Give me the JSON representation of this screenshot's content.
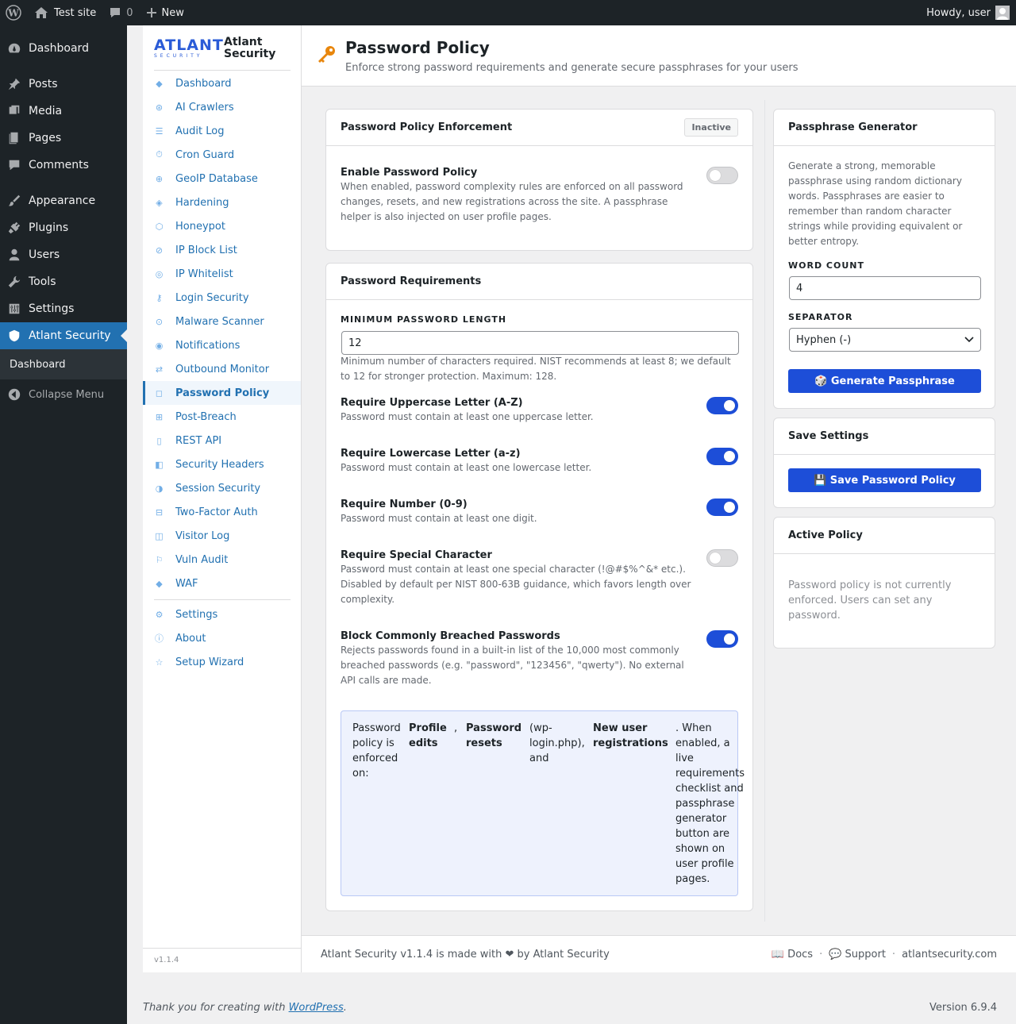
{
  "adminbar": {
    "site_name": "Test site",
    "comments_count": "0",
    "new_label": "New",
    "howdy": "Howdy, user"
  },
  "wp_menu": {
    "items": [
      {
        "label": "Dashboard",
        "icon": "dashboard-icon"
      },
      {
        "label": "Posts",
        "icon": "pin-icon"
      },
      {
        "label": "Media",
        "icon": "media-icon"
      },
      {
        "label": "Pages",
        "icon": "pages-icon"
      },
      {
        "label": "Comments",
        "icon": "comment-icon"
      },
      {
        "label": "Appearance",
        "icon": "brush-icon"
      },
      {
        "label": "Plugins",
        "icon": "plug-icon"
      },
      {
        "label": "Users",
        "icon": "user-icon"
      },
      {
        "label": "Tools",
        "icon": "wrench-icon"
      },
      {
        "label": "Settings",
        "icon": "sliders-icon"
      },
      {
        "label": "Atlant Security",
        "icon": "shield-icon"
      }
    ],
    "submenu": "Dashboard",
    "collapse": "Collapse Menu"
  },
  "plugin": {
    "brand_logo": "ATLANT",
    "brand_logo_sub": "SECURITY",
    "brand_name_1": "Atlant",
    "brand_name_2": "Security",
    "nav": [
      {
        "label": "Dashboard",
        "glyph": "◆"
      },
      {
        "label": "AI Crawlers",
        "glyph": "⊛"
      },
      {
        "label": "Audit Log",
        "glyph": "☰"
      },
      {
        "label": "Cron Guard",
        "glyph": "⏱"
      },
      {
        "label": "GeoIP Database",
        "glyph": "⊕"
      },
      {
        "label": "Hardening",
        "glyph": "◈"
      },
      {
        "label": "Honeypot",
        "glyph": "⬡"
      },
      {
        "label": "IP Block List",
        "glyph": "⊘"
      },
      {
        "label": "IP Whitelist",
        "glyph": "◎"
      },
      {
        "label": "Login Security",
        "glyph": "⚷"
      },
      {
        "label": "Malware Scanner",
        "glyph": "⊙"
      },
      {
        "label": "Notifications",
        "glyph": "◉"
      },
      {
        "label": "Outbound Monitor",
        "glyph": "⇄"
      },
      {
        "label": "Password Policy",
        "glyph": "◻"
      },
      {
        "label": "Post-Breach",
        "glyph": "⊞"
      },
      {
        "label": "REST API",
        "glyph": "▯"
      },
      {
        "label": "Security Headers",
        "glyph": "◧"
      },
      {
        "label": "Session Security",
        "glyph": "◑"
      },
      {
        "label": "Two-Factor Auth",
        "glyph": "⊟"
      },
      {
        "label": "Visitor Log",
        "glyph": "◫"
      },
      {
        "label": "Vuln Audit",
        "glyph": "⚐"
      },
      {
        "label": "WAF",
        "glyph": "◆"
      }
    ],
    "nav_bottom": [
      {
        "label": "Settings",
        "glyph": "⚙"
      },
      {
        "label": "About",
        "glyph": "ⓘ"
      },
      {
        "label": "Setup Wizard",
        "glyph": "☆"
      }
    ],
    "version": "v1.1.4"
  },
  "page": {
    "title": "Password Policy",
    "subtitle": "Enforce strong password requirements and generate secure passphrases for your users"
  },
  "enforcement": {
    "title": "Password Policy Enforcement",
    "badge": "Inactive",
    "enable_title": "Enable Password Policy",
    "enable_desc_1": "When enabled, password complexity rules are enforced on all password",
    "enable_desc_2": "changes, resets, and new registrations across the site. A passphrase",
    "enable_desc_3": "helper is also injected on user profile pages.",
    "enabled": false
  },
  "requirements": {
    "title": "Password Requirements",
    "min_length_label": "MINIMUM PASSWORD LENGTH",
    "min_length_value": "12",
    "min_length_help_1": "Minimum number of characters required. NIST recommends at least 8; we default",
    "min_length_help_2": "to 12 for stronger protection. Maximum: 128.",
    "rules": [
      {
        "title": "Require Uppercase Letter (A-Z)",
        "lines": [
          "Password must contain at least one uppercase letter."
        ],
        "on": true
      },
      {
        "title": "Require Lowercase Letter (a-z)",
        "lines": [
          "Password must contain at least one lowercase letter."
        ],
        "on": true
      },
      {
        "title": "Require Number (0-9)",
        "lines": [
          "Password must contain at least one digit."
        ],
        "on": true
      },
      {
        "title": "Require Special Character",
        "lines": [
          "Password must contain at least one special character (!@#$%^&* etc.).",
          "Disabled by default per NIST 800-63B guidance, which favors length over",
          "complexity."
        ],
        "on": false
      },
      {
        "title": "Block Commonly Breached Passwords",
        "lines": [
          "Rejects passwords found in a built-in list of the 10,000 most commonly",
          "breached passwords (e.g. \"password\", \"123456\", \"qwerty\"). No external",
          "API calls are made."
        ],
        "on": true
      }
    ],
    "info": {
      "c1": [
        "Password",
        "policy is",
        "enforced",
        "on:"
      ],
      "c2": [
        "Profile",
        "edits"
      ],
      "c3": [
        ","
      ],
      "c4": [
        "Password",
        "resets"
      ],
      "c5": [
        "(wp-",
        "login.php),",
        "and"
      ],
      "c6": [
        "New user",
        "registrations"
      ],
      "c7": [
        ". When",
        "enabled, a",
        "live",
        "requirements",
        "checklist and",
        "passphrase",
        "generator",
        "button are",
        "shown on",
        "user profile",
        "pages."
      ]
    }
  },
  "generator": {
    "title": "Passphrase Generator",
    "desc": [
      "Generate a strong, memorable",
      "passphrase using random dictionary",
      "words. Passphrases are easier to",
      "remember than random character",
      "strings while providing equivalent or",
      "better entropy."
    ],
    "word_count_label": "WORD COUNT",
    "word_count_value": "4",
    "separator_label": "SEPARATOR",
    "separator_value": "Hyphen (-)",
    "button": "🎲 Generate Passphrase"
  },
  "save": {
    "title": "Save Settings",
    "button": "💾 Save Password Policy"
  },
  "active": {
    "title": "Active Policy",
    "lines": [
      "Password policy is not currently",
      "enforced. Users can set any",
      "password."
    ]
  },
  "footer": {
    "made_with": "Atlant Security v1.1.4 is made with ❤ by Atlant Security",
    "docs": "📖 Docs",
    "dot1": "·",
    "support": "💬 Support",
    "dot2": "·",
    "site": "atlantsecurity.com"
  },
  "wp_footer": {
    "thanks": "Thank you for creating with ",
    "wordpress": "WordPress",
    "period": ".",
    "version": "Version 6.9.4"
  },
  "colors": {
    "accent": "#1d4ed8",
    "wp_blue": "#2271b1",
    "key_orange": "#e8860c"
  }
}
